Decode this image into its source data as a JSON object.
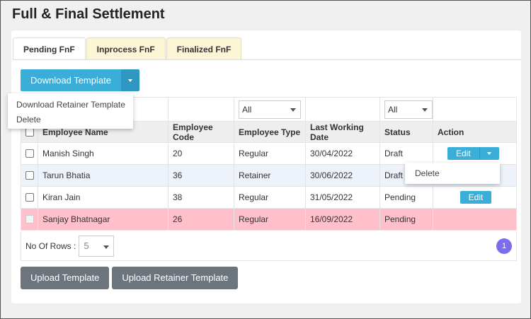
{
  "page": {
    "title": "Full & Final Settlement"
  },
  "tabs": [
    {
      "label": "Pending FnF",
      "active": true
    },
    {
      "label": "Inprocess FnF",
      "active": false
    },
    {
      "label": "Finalized FnF",
      "active": false
    }
  ],
  "download": {
    "label": "Download Template",
    "menu": [
      "Download Retainer Template",
      "Delete"
    ]
  },
  "filters": {
    "employee_type": "All",
    "status": "All"
  },
  "table": {
    "headers": [
      "Employee Name",
      "Employee Code",
      "Employee Type",
      "Last Working Date",
      "Status",
      "Action"
    ],
    "rows": [
      {
        "name": "Manish Singh",
        "code": "20",
        "type": "Regular",
        "lwd": "30/04/2022",
        "status": "Draft",
        "action": "Edit"
      },
      {
        "name": "Tarun Bhatia",
        "code": "36",
        "type": "Retainer",
        "lwd": "30/06/2022",
        "status": "Draft",
        "action": ""
      },
      {
        "name": "Kiran Jain",
        "code": "38",
        "type": "Regular",
        "lwd": "31/05/2022",
        "status": "Pending",
        "action": "Edit"
      },
      {
        "name": "Sanjay Bhatnagar",
        "code": "26",
        "type": "Regular",
        "lwd": "16/09/2022",
        "status": "Pending",
        "action": ""
      }
    ],
    "row_menu": "Delete"
  },
  "pagination": {
    "rows_label": "No Of Rows :",
    "rows_value": "5",
    "current_page": "1"
  },
  "buttons": {
    "upload": "Upload Template",
    "upload_retainer": "Upload Retainer Template"
  },
  "colors": {
    "primary": "#3aaed8",
    "secondary": "#6c757d",
    "highlight_row": "#ffc0cb",
    "page_badge": "#7b6cf0"
  }
}
